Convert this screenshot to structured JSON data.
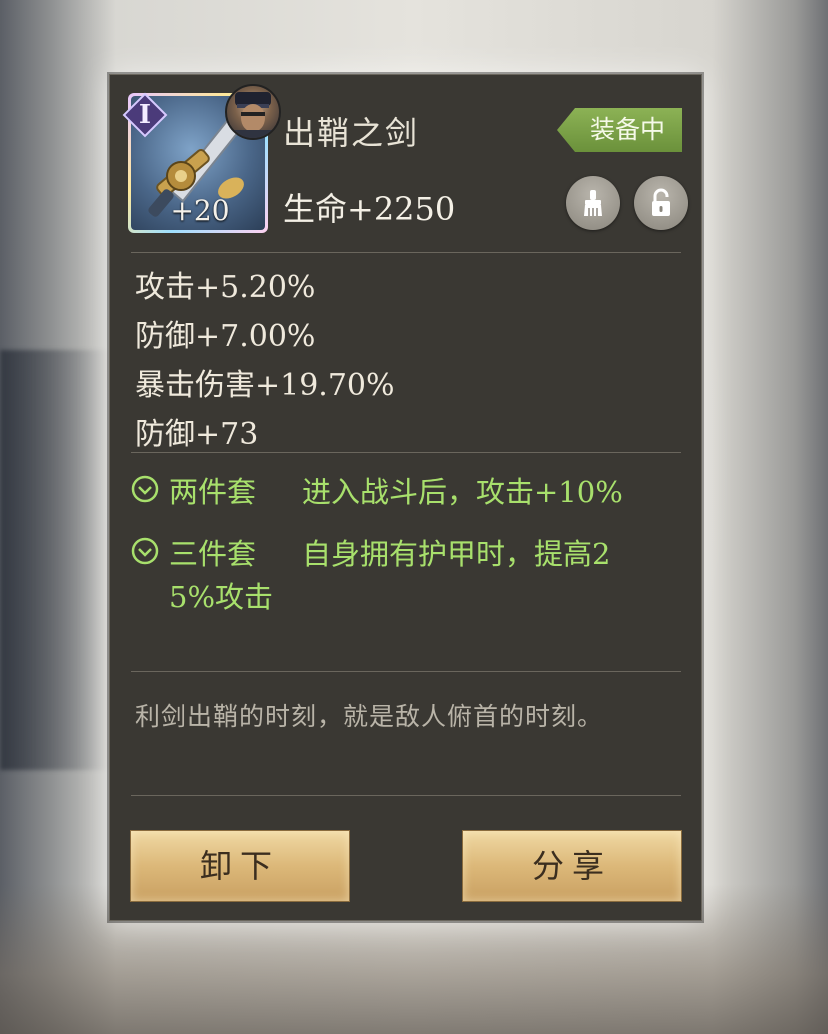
{
  "item": {
    "name": "出鞘之剑",
    "rank": "I",
    "level": "+20",
    "main_stat": "生命+2250",
    "status_tag": "装备中"
  },
  "substats": [
    "攻击+5.20%",
    "防御+7.00%",
    "暴击伤害+19.70%",
    "防御+73"
  ],
  "set_bonuses": [
    {
      "label": "两件套",
      "effect": "进入战斗后，攻击+10%"
    },
    {
      "label": "三件套",
      "effect_line1": "自身拥有护甲时，提高2",
      "effect_line2": "5%攻击"
    }
  ],
  "description": "利剑出鞘的时刻，就是敌人俯首的时刻。",
  "buttons": {
    "unequip": "卸下",
    "share": "分享"
  },
  "icons": {
    "clean": "brush-icon",
    "lock": "unlock-icon"
  },
  "colors": {
    "accent_green": "#a8e06c",
    "tag_green": "#7aa347",
    "button_gold": "#dcb879"
  }
}
